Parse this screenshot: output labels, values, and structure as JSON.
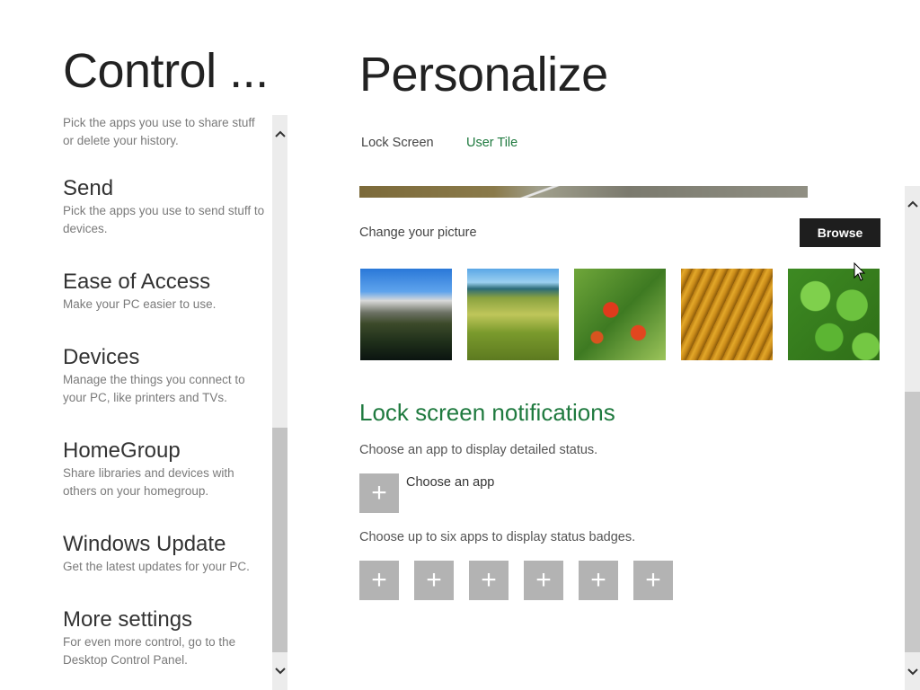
{
  "left_pane": {
    "title": "Control ...",
    "items": [
      {
        "name": "",
        "description": "Pick the apps you use to share stuff or delete your history."
      },
      {
        "name": "Send",
        "description": "Pick the apps you use to send stuff to devices."
      },
      {
        "name": "Ease of Access",
        "description": "Make your PC easier to use."
      },
      {
        "name": "Devices",
        "description": "Manage the things you connect to your PC, like printers and TVs."
      },
      {
        "name": "HomeGroup",
        "description": "Share libraries and devices with others on your homegroup."
      },
      {
        "name": "Windows Update",
        "description": "Get the latest updates for your PC."
      },
      {
        "name": "More settings",
        "description": "For even more control, go to the Desktop Control Panel."
      }
    ],
    "scroll_up_icon": "chevron-up-icon",
    "scroll_down_icon": "chevron-down-icon"
  },
  "right_pane": {
    "title": "Personalize",
    "tabs": [
      {
        "label": "Lock Screen",
        "selected": false
      },
      {
        "label": "User Tile",
        "selected": true
      }
    ],
    "change_picture_label": "Change your picture",
    "browse_label": "Browse",
    "pictures": [
      {
        "icon": "mountain-lake-picture"
      },
      {
        "icon": "green-hills-picture"
      },
      {
        "icon": "red-flowers-picture"
      },
      {
        "icon": "golden-grass-picture"
      },
      {
        "icon": "clover-picture"
      }
    ],
    "notifications": {
      "heading": "Lock screen notifications",
      "detailed_status_text": "Choose an app to display detailed status.",
      "choose_app_label": "Choose an app",
      "plus_symbol": "+",
      "badges_text": "Choose up to six apps to display status badges.",
      "badge_slots": 6
    }
  },
  "colors": {
    "accent_green": "#1f7a3f",
    "tile_gray": "#b3b3b3",
    "browse_button": "#1e1e1e"
  }
}
